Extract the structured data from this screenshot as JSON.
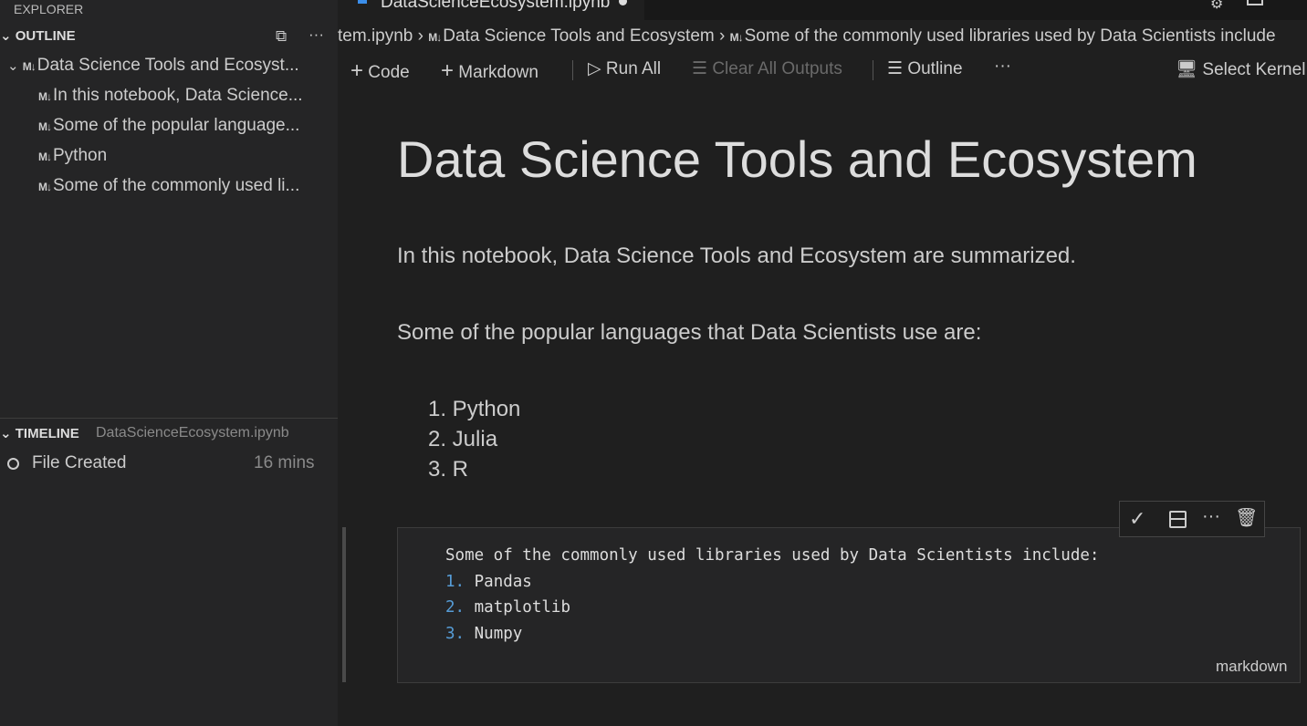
{
  "sidebar": {
    "explorer_title": "EXPLORER",
    "outline": {
      "title": "OUTLINE",
      "items": [
        {
          "label": "Data Science Tools and Ecosyst...",
          "level": 0
        },
        {
          "label": "In this notebook, Data Science...",
          "level": 1
        },
        {
          "label": "Some of the popular language...",
          "level": 1
        },
        {
          "label": "Python",
          "level": 1
        },
        {
          "label": "Some of the commonly used li...",
          "level": 1
        }
      ],
      "md_badge": "M↓"
    },
    "timeline": {
      "title": "TIMELINE",
      "file": "DataScienceEcosystem.ipynb",
      "events": [
        {
          "label": "File Created",
          "time": "16 mins"
        }
      ]
    }
  },
  "tab": {
    "label": "DataScienceEcosystem.ipynb"
  },
  "breadcrumb": [
    "tem.ipynb",
    "Data Science Tools and Ecosystem",
    "Some of the commonly used libraries used by Data Scientists include"
  ],
  "toolbar": {
    "code": "Code",
    "markdown": "Markdown",
    "run_all": "Run All",
    "clear_all": "Clear All Outputs",
    "outline": "Outline",
    "select_kernel": "Select Kernel"
  },
  "notebook": {
    "heading": "Data Science Tools and Ecosystem",
    "intro": "In this notebook, Data Science Tools and Ecosystem are summarized.",
    "languages_intro": "Some of the popular languages that Data Scientists use are:",
    "languages": [
      "1. Python",
      "2. Julia",
      "3. R"
    ],
    "editing_cell": {
      "lines": [
        {
          "num": "",
          "text": "Some of the commonly used libraries used by Data Scientists include:"
        },
        {
          "num": "1.",
          "text": "Pandas"
        },
        {
          "num": "2.",
          "text": "matplotlib"
        },
        {
          "num": "3.",
          "text": "Numpy"
        }
      ],
      "language": "markdown"
    }
  }
}
